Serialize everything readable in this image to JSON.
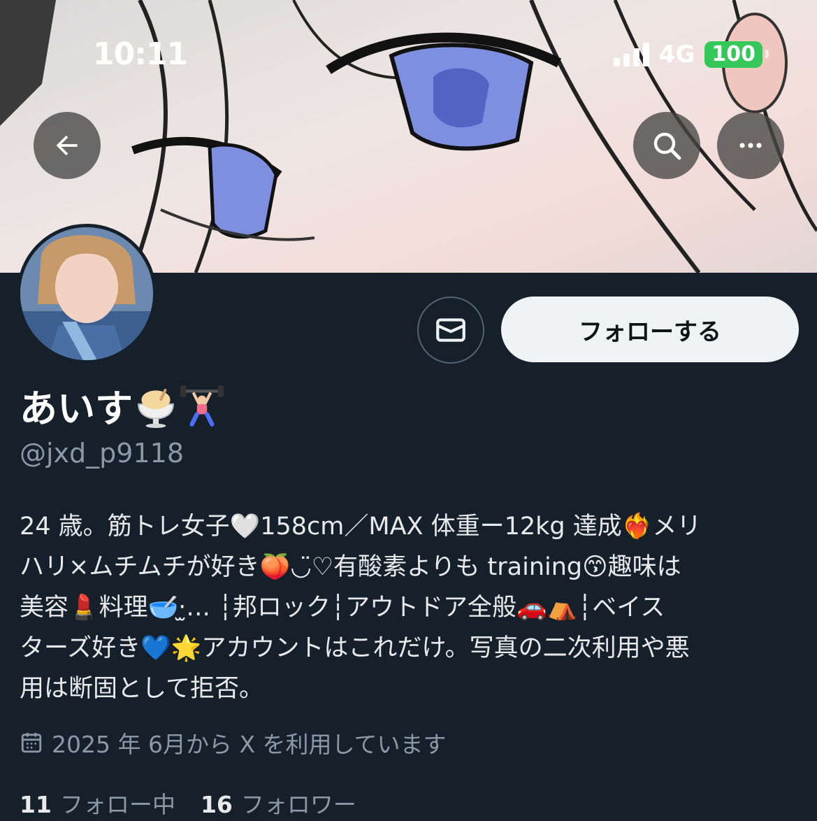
{
  "status_bar": {
    "time": "10:11",
    "network": "4G",
    "battery": "100"
  },
  "nav": {
    "back_icon": "arrow-left-icon",
    "search_icon": "search-icon",
    "more_icon": "more-dots-icon"
  },
  "profile": {
    "name": "あいす",
    "name_emojis": [
      "ice-cream-icon",
      "weightlifting-icon"
    ],
    "handle": "@jxd_p9118",
    "bio_lines": [
      "24 歳。筋トレ女子🤍158cm／MAX 体重ー12kg 達成❤️‍🔥メリ",
      "ハリ×ムチムチが好き🍑◡̈♡有酸素よりも training😙趣味は",
      "美容💄料理🥣‧̫‥. ┆邦ロック┆アウトドア全般🚗⛺️┆ベイス",
      "ターズ好き💙🌟アカウントはこれだけ。写真の二次利用や悪",
      "用は断固として拒否。"
    ],
    "joined": "2025 年 6月から X を利用しています",
    "following_count": "11",
    "following_label": "フォロー中",
    "followers_count": "16",
    "followers_label": "フォロワー"
  },
  "actions": {
    "message_icon": "envelope-icon",
    "follow_label": "フォローする"
  },
  "colors": {
    "background": "#15202b",
    "secondary_text": "#8b98a5",
    "follow_bg": "#eff3f4"
  }
}
